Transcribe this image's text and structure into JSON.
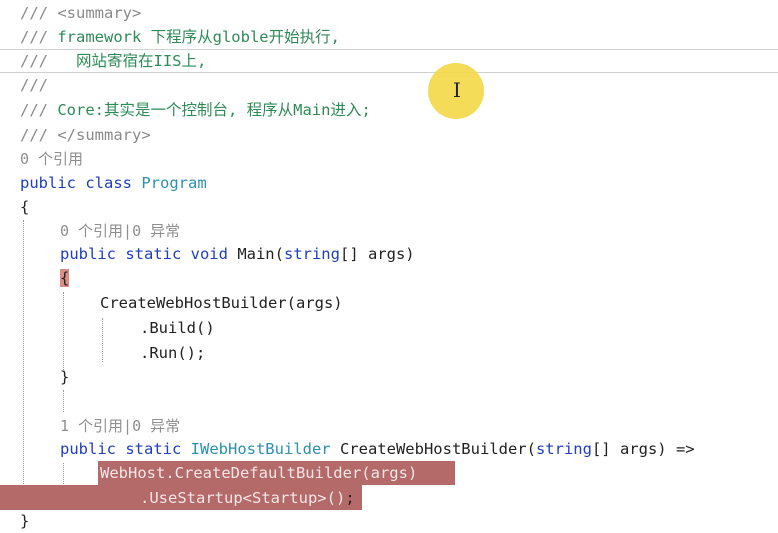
{
  "editor": {
    "lines": {
      "l1": "/// <summary>",
      "l2a": "/// ",
      "l2b": "framework 下程序从globle开始执行,",
      "l3a": "///   ",
      "l3b": "网站寄宿在IIS上,",
      "l4": "///",
      "l5a": "/// ",
      "l5b": "Core:其实是一个控制台, 程序从Main进入;",
      "l6": "/// </summary>",
      "l7": "0 个引用",
      "l8a": "public class ",
      "l8b": "Program",
      "l9": "{",
      "l10": "0 个引用|0 异常",
      "l11a": "public static void ",
      "l11b": "Main(",
      "l11c": "string",
      "l11d": "[] args)",
      "l12": "{",
      "l13": "CreateWebHostBuilder(args)",
      "l14": ".Build()",
      "l15": ".Run();",
      "l16": "}",
      "l17": "1 个引用|0 异常",
      "l18a": "public static ",
      "l18b": "IWebHostBuilder",
      "l18c": " CreateWebHostBuilder(",
      "l18d": "string",
      "l18e": "[] args) =>",
      "l19": "WebHost.CreateDefaultBuilder(args)",
      "l20a": ".UseStartup<Startup>()",
      "l20b": ";",
      "l21": "}"
    }
  },
  "cursor": {
    "icon": "i-beam-cursor",
    "symbol": "I",
    "highlight_color": "#f3d94a"
  },
  "colors": {
    "comment": "#8a8a8a",
    "doc_text": "#2e8b57",
    "keyword": "#1f3fbf",
    "type": "#2b91af",
    "selection": "#b56a6a"
  }
}
